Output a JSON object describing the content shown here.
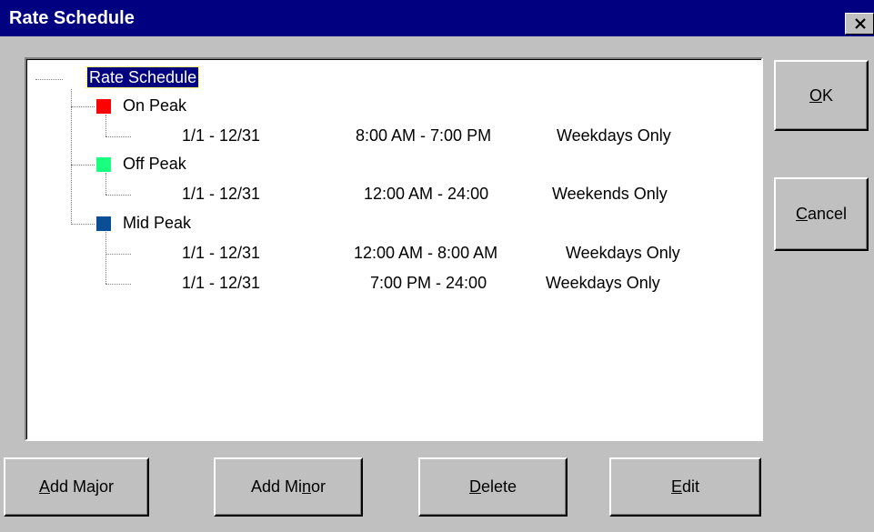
{
  "window": {
    "title": "Rate Schedule",
    "close_glyph": "×"
  },
  "tree": {
    "root_label": "Rate Schedule",
    "periods": [
      {
        "label": "On Peak",
        "color": "#ff0000",
        "entries": [
          {
            "dates": "1/1 - 12/31",
            "time": "8:00 AM - 7:00 PM",
            "days": "Weekdays Only"
          }
        ]
      },
      {
        "label": "Off Peak",
        "color": "#19ff80",
        "entries": [
          {
            "dates": "1/1 - 12/31",
            "time": "12:00 AM - 24:00",
            "days": "Weekends Only"
          }
        ]
      },
      {
        "label": "Mid Peak",
        "color": "#0a4e96",
        "entries": [
          {
            "dates": "1/1 - 12/31",
            "time": "12:00 AM - 8:00 AM",
            "days": "Weekdays Only"
          },
          {
            "dates": "1/1 - 12/31",
            "time": "7:00 PM - 24:00",
            "days": "Weekdays Only"
          }
        ]
      }
    ]
  },
  "buttons": {
    "ok": {
      "label": "OK",
      "mnemonic": "O"
    },
    "cancel": {
      "label": "Cancel",
      "mnemonic": "C"
    },
    "add_major": {
      "label": "Add Major",
      "mnemonic": "A"
    },
    "add_minor": {
      "label": "Add Minor",
      "mnemonic": "n"
    },
    "delete": {
      "label": "Delete",
      "mnemonic": "D"
    },
    "edit": {
      "label": "Edit",
      "mnemonic": "E"
    }
  }
}
